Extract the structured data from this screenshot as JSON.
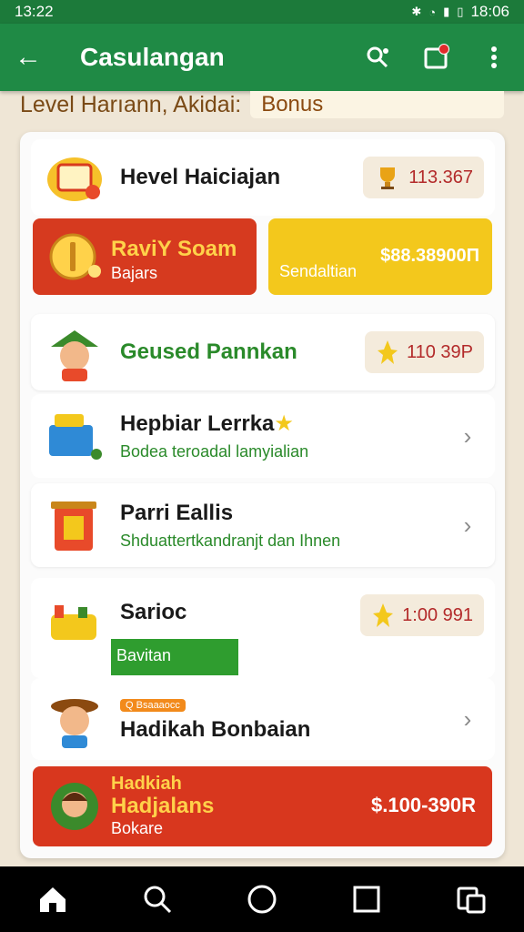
{
  "status_bar": {
    "time": "13:22",
    "right_time": "18:06"
  },
  "app_bar": {
    "title": "Casulangan"
  },
  "level_bar": {
    "label": "Level Harıann, Akidai:",
    "bonus": "Bonus"
  },
  "rows": {
    "hevel": {
      "title": "Hevel Haiciajan",
      "value": "113.367"
    },
    "promo_red": {
      "title": "RaviY Soam",
      "sub": "Bajars"
    },
    "promo_yellow": {
      "amount": "$88.38900П",
      "sub": "Sendaltian"
    },
    "geused": {
      "title": "Geused Pannkan",
      "value": "110 39P"
    },
    "hepbiar": {
      "title": "Hepbiar Lerrka",
      "sub": "Bodea teroadal lamyialian"
    },
    "parri": {
      "title": "Parri Eallis",
      "sub": "Shduattertkandranjt dan Ihnen"
    },
    "sarioc": {
      "title": "Sarioc",
      "value": "1:00 991",
      "green_label": "Bavitan"
    },
    "hadikah": {
      "title": "Hadikah Bonbaian",
      "tag": "Q Bsaaaocc"
    },
    "bigpromo": {
      "line1": "Hadkiah",
      "line2": "Hadjalans",
      "line3": "Bokare",
      "amount": "$.100-390R"
    }
  },
  "colors": {
    "primary_green": "#1f8a45",
    "promo_red": "#d63a1f",
    "promo_yellow": "#f3c81c",
    "value_red": "#b32a2a"
  },
  "icons": [
    "back-arrow-icon",
    "search-user-icon",
    "inbox-icon",
    "more-vert-icon",
    "home-icon",
    "search-icon",
    "circle-home-icon",
    "square-recents-icon",
    "multiwindow-icon",
    "trophy-icon",
    "star-icon",
    "chevron-right-icon"
  ]
}
